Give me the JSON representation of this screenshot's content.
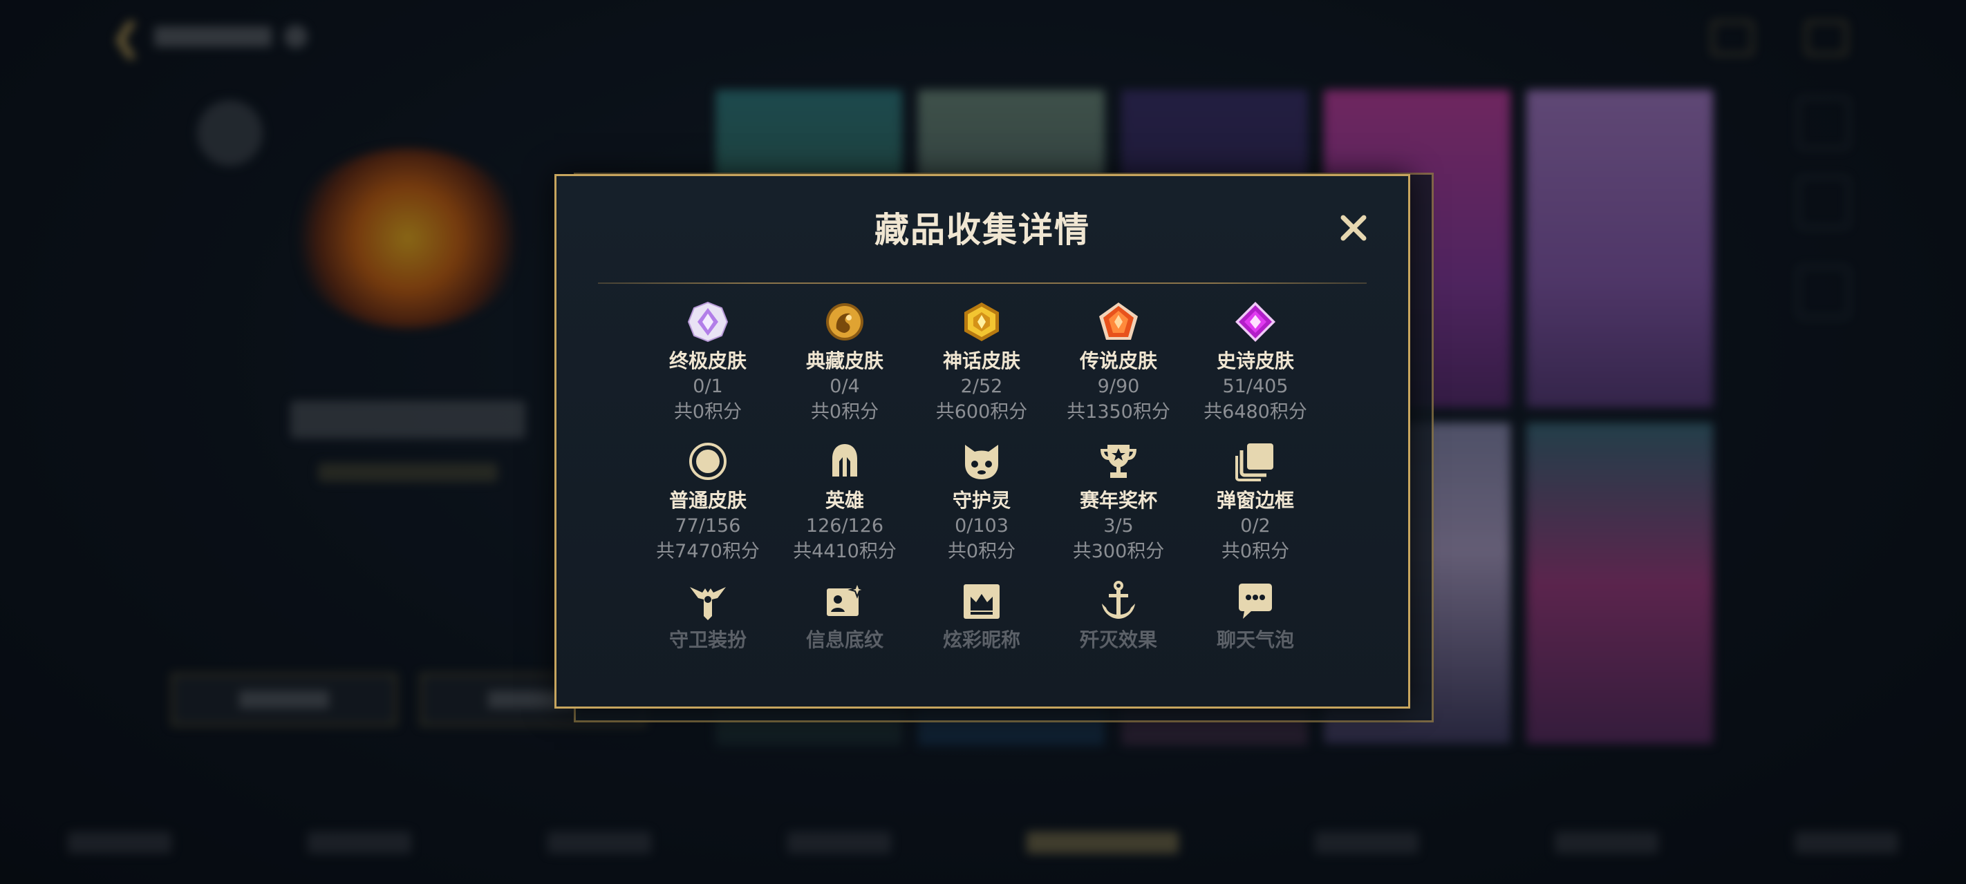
{
  "modal": {
    "title": "藏品收集详情",
    "close_label": "✕",
    "items": [
      {
        "name": "终极皮肤",
        "count": "0/1",
        "points": "共0积分",
        "icon": "ultimate-skin-icon"
      },
      {
        "name": "典藏皮肤",
        "count": "0/4",
        "points": "共0积分",
        "icon": "prestige-skin-icon"
      },
      {
        "name": "神话皮肤",
        "count": "2/52",
        "points": "共600积分",
        "icon": "mythic-skin-icon"
      },
      {
        "name": "传说皮肤",
        "count": "9/90",
        "points": "共1350积分",
        "icon": "legendary-skin-icon"
      },
      {
        "name": "史诗皮肤",
        "count": "51/405",
        "points": "共6480积分",
        "icon": "epic-skin-icon"
      },
      {
        "name": "普通皮肤",
        "count": "77/156",
        "points": "共7470积分",
        "icon": "standard-skin-icon"
      },
      {
        "name": "英雄",
        "count": "126/126",
        "points": "共4410积分",
        "icon": "champion-helmet-icon"
      },
      {
        "name": "守护灵",
        "count": "0/103",
        "points": "共0积分",
        "icon": "guardian-spirit-icon"
      },
      {
        "name": "赛年奖杯",
        "count": "3/5",
        "points": "共300积分",
        "icon": "season-trophy-icon"
      },
      {
        "name": "弹窗边框",
        "count": "0/2",
        "points": "共0积分",
        "icon": "popup-frame-icon"
      },
      {
        "name": "守卫装扮",
        "icon": "ward-skin-icon"
      },
      {
        "name": "信息底纹",
        "icon": "info-banner-icon"
      },
      {
        "name": "炫彩昵称",
        "icon": "color-nickname-icon"
      },
      {
        "name": "歼灭效果",
        "icon": "elimination-effect-icon"
      },
      {
        "name": "聊天气泡",
        "icon": "chat-bubble-icon"
      }
    ]
  },
  "colors": {
    "gold_border": "#c7a55e",
    "title_text": "#f0e6d2",
    "secondary_text": "#8c8f94",
    "panel_bg": "#131b24"
  }
}
